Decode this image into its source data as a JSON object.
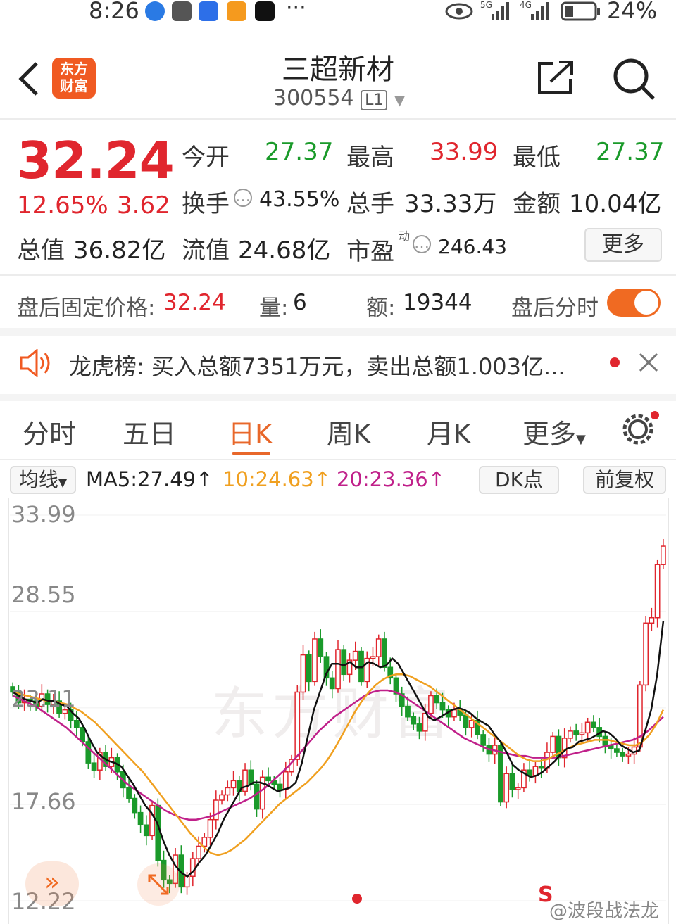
{
  "status_bar": {
    "time": "8:26",
    "more": "···",
    "sig1": "5G",
    "sig2": "4G",
    "battery": "24%",
    "icons": [
      "globe-icon",
      "mail-icon",
      "baidu-icon",
      "app-icon",
      "tiktok-icon"
    ]
  },
  "header": {
    "title": "三超新材",
    "code": "300554",
    "level_badge": "L1",
    "logo_line1": "东方",
    "logo_line2": "财富"
  },
  "quote": {
    "price": "32.24",
    "change_pct": "12.65%",
    "change_amt": "3.62",
    "open_label": "今开",
    "open": "27.37",
    "high_label": "最高",
    "high": "33.99",
    "low_label": "最低",
    "low": "27.37",
    "turnover_label": "换手",
    "turnover": "43.55%",
    "volume_label": "总手",
    "volume": "33.33万",
    "amount_label": "金额",
    "amount": "10.04亿",
    "mktcap_label": "总值",
    "mktcap": "36.82亿",
    "float_label": "流值",
    "float": "24.68亿",
    "pe_label": "市盈",
    "pe_sup": "动",
    "pe": "246.43",
    "more_button": "更多"
  },
  "after_hours": {
    "price_label": "盘后固定价格:",
    "price": "32.24",
    "vol_label": "量:",
    "vol": "6",
    "amt_label": "额:",
    "amt": "19344",
    "toggle_label": "盘后分时"
  },
  "notice": {
    "label": "龙虎榜:",
    "text": "买入总额7351万元，卖出总额1.003亿..."
  },
  "tabs": [
    "分时",
    "五日",
    "日K",
    "周K",
    "月K",
    "更多"
  ],
  "chart_controls": {
    "ma_dropdown": "均线",
    "ma5": "MA5:27.49↑",
    "ma10": "10:24.63↑",
    "ma20": "20:23.36↑",
    "dk_button": "DK点",
    "adjust_button": "前复权"
  },
  "chart_data": {
    "type": "candlestick",
    "y_ticks": [
      "33.99",
      "28.55",
      "23.11",
      "17.66",
      "12.22"
    ],
    "ylim": [
      12.22,
      33.99
    ],
    "series": [
      {
        "name": "MA5",
        "color": "#111111"
      },
      {
        "name": "MA10",
        "color": "#f0a020"
      },
      {
        "name": "MA20",
        "color": "#c0208a"
      }
    ],
    "closes": [
      24.0,
      23.4,
      23.6,
      23.5,
      23.2,
      23.9,
      23.3,
      23.5,
      22.8,
      23.0,
      22.4,
      22.0,
      21.2,
      20.0,
      19.6,
      20.6,
      19.8,
      20.3,
      19.5,
      18.6,
      18.0,
      17.2,
      16.5,
      15.9,
      17.6,
      14.5,
      13.4,
      13.2,
      14.8,
      13.0,
      13.6,
      14.6,
      15.3,
      15.8,
      16.8,
      17.9,
      18.2,
      18.6,
      19.0,
      18.4,
      19.6,
      18.8,
      17.4,
      19.2,
      19.0,
      18.8,
      18.5,
      19.5,
      20.2,
      24.0,
      26.1,
      24.6,
      27.0,
      26.0,
      24.8,
      24.2,
      26.4,
      25.0,
      25.8,
      26.3,
      24.6,
      25.9,
      26.0,
      27.0,
      25.4,
      24.8,
      23.9,
      23.2,
      22.6,
      22.2,
      21.8,
      22.8,
      23.8,
      23.4,
      23.0,
      22.6,
      23.0,
      22.7,
      22.0,
      22.4,
      21.6,
      21.0,
      20.5,
      21.0,
      17.8,
      19.4,
      18.5,
      18.6,
      19.6,
      19.3,
      19.8,
      19.7,
      20.6,
      21.5,
      20.3,
      21.4,
      21.8,
      21.6,
      21.7,
      22.3,
      22.0,
      21.5,
      21.0,
      20.8,
      20.6,
      20.4,
      20.5,
      20.9,
      24.4,
      27.9,
      28.2,
      31.2,
      32.24
    ],
    "ma5": [
      24.0,
      23.8,
      23.6,
      23.5,
      23.4,
      23.6,
      23.5,
      23.5,
      23.3,
      23.2,
      22.8,
      22.5,
      21.9,
      21.2,
      20.6,
      20.3,
      20.1,
      20.0,
      19.8,
      19.3,
      18.8,
      18.2,
      17.6,
      17.2,
      16.6,
      15.6,
      14.8,
      14.2,
      13.8,
      13.6,
      13.9,
      14.4,
      14.8,
      15.4,
      16.0,
      16.8,
      17.4,
      18.0,
      18.6,
      18.7,
      18.9,
      18.9,
      18.8,
      18.6,
      18.4,
      18.5,
      18.6,
      18.9,
      20.0,
      21.5,
      23.0,
      24.0,
      25.0,
      25.6,
      25.6,
      25.5,
      25.7,
      25.4,
      25.4,
      25.7,
      25.6,
      25.4,
      25.5,
      25.9,
      25.6,
      25.0,
      24.4,
      23.8,
      23.2,
      22.6,
      22.4,
      22.6,
      22.8,
      23.0,
      23.1,
      23.0,
      22.8,
      22.5,
      22.3,
      22.1,
      21.6,
      21.2,
      20.6,
      19.9,
      19.6,
      19.4,
      19.2,
      19.3,
      19.5,
      19.8,
      20.1,
      20.5,
      20.8,
      20.9,
      21.2,
      21.3,
      21.4,
      21.6,
      21.8,
      21.7,
      21.4,
      21.0,
      20.8,
      20.6,
      20.7,
      21.8,
      23.0,
      25.0,
      28.0
    ],
    "ma10": [
      24.0,
      23.9,
      23.8,
      23.7,
      23.6,
      23.5,
      23.5,
      23.4,
      23.3,
      23.1,
      22.9,
      22.6,
      22.3,
      21.9,
      21.5,
      21.1,
      20.7,
      20.3,
      19.9,
      19.5,
      19.0,
      18.5,
      18.0,
      17.5,
      17.0,
      16.5,
      16.0,
      15.6,
      15.2,
      14.9,
      14.8,
      14.9,
      15.1,
      15.4,
      15.7,
      16.1,
      16.5,
      16.9,
      17.3,
      17.7,
      18.0,
      18.3,
      18.6,
      18.9,
      19.3,
      19.7,
      20.2,
      20.8,
      21.5,
      22.2,
      22.9,
      23.5,
      24.0,
      24.4,
      24.7,
      24.9,
      25.0,
      25.0,
      24.9,
      24.7,
      24.5,
      24.3,
      24.0,
      23.7,
      23.4,
      23.1,
      22.8,
      22.5,
      22.2,
      21.9,
      21.6,
      21.3,
      21.0,
      20.7,
      20.4,
      20.2,
      20.1,
      20.1,
      20.2,
      20.4,
      20.6,
      20.8,
      21.0,
      21.1,
      21.2,
      21.3,
      21.3,
      21.3,
      21.2,
      21.1,
      21.0,
      21.0,
      21.2,
      21.6,
      22.2,
      23.0
    ],
    "ma20": [
      23.8,
      23.6,
      23.4,
      23.2,
      22.9,
      22.6,
      22.3,
      22.0,
      21.6,
      21.2,
      20.8,
      20.4,
      20.0,
      19.6,
      19.2,
      18.8,
      18.5,
      18.2,
      17.9,
      17.6,
      17.3,
      17.1,
      16.9,
      16.8,
      16.8,
      16.9,
      17.0,
      17.2,
      17.4,
      17.6,
      17.8,
      18.0,
      18.3,
      18.6,
      19.0,
      19.4,
      19.8,
      20.3,
      20.8,
      21.3,
      21.8,
      22.2,
      22.6,
      22.9,
      23.2,
      23.5,
      23.8,
      24.0,
      24.1,
      24.1,
      24.0,
      23.8,
      23.5,
      23.2,
      22.9,
      22.6,
      22.3,
      22.0,
      21.7,
      21.4,
      21.2,
      21.0,
      20.8,
      20.7,
      20.6,
      20.5,
      20.4,
      20.4,
      20.3,
      20.3,
      20.3,
      20.3,
      20.4,
      20.5,
      20.6,
      20.7,
      20.8,
      20.9,
      21.0,
      21.1,
      21.2,
      21.3,
      21.5,
      21.8,
      22.2,
      22.6
    ]
  },
  "watermark": "东方财富",
  "footer_mark": "S",
  "weibo_credit": "@波段战法龙"
}
